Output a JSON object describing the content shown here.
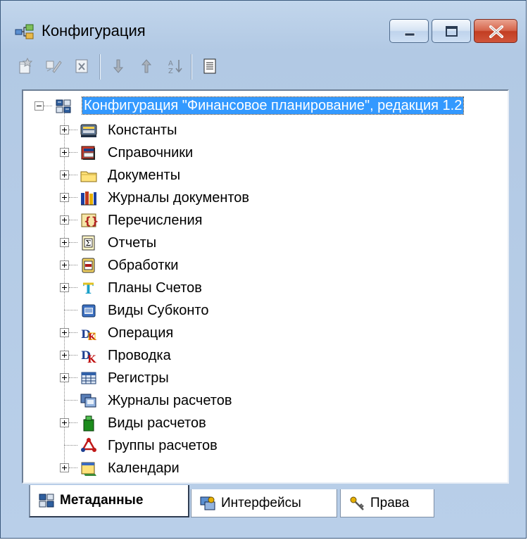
{
  "window": {
    "title": "Конфигурация",
    "controls": {
      "minimize": "minimize-icon",
      "maximize": "maximize-icon",
      "close": "close-icon"
    }
  },
  "toolbar": {
    "buttons": [
      {
        "icon": "new-item-icon"
      },
      {
        "icon": "edit-item-icon"
      },
      {
        "icon": "delete-item-icon"
      },
      {
        "icon": "move-down-icon"
      },
      {
        "icon": "move-up-icon"
      },
      {
        "icon": "sort-az-icon"
      },
      {
        "icon": "properties-icon"
      }
    ]
  },
  "tree": {
    "root": {
      "label": "Конфигурация \"Финансовое планирование\", редакция 1.2",
      "expanded": true,
      "selected": true
    },
    "items": [
      {
        "label": "Константы",
        "expandable": true,
        "icon": "constants-icon"
      },
      {
        "label": "Справочники",
        "expandable": true,
        "icon": "catalogs-icon"
      },
      {
        "label": "Документы",
        "expandable": true,
        "icon": "documents-folder-icon"
      },
      {
        "label": "Журналы документов",
        "expandable": true,
        "icon": "document-journals-icon"
      },
      {
        "label": "Перечисления",
        "expandable": true,
        "icon": "enumerations-icon"
      },
      {
        "label": "Отчеты",
        "expandable": true,
        "icon": "reports-icon"
      },
      {
        "label": "Обработки",
        "expandable": true,
        "icon": "processing-icon"
      },
      {
        "label": "Планы Счетов",
        "expandable": true,
        "icon": "chart-of-accounts-icon"
      },
      {
        "label": "Виды Субконто",
        "expandable": false,
        "icon": "subconto-types-icon"
      },
      {
        "label": "Операция",
        "expandable": true,
        "icon": "operation-icon"
      },
      {
        "label": "Проводка",
        "expandable": true,
        "icon": "entry-icon"
      },
      {
        "label": "Регистры",
        "expandable": true,
        "icon": "registers-icon"
      },
      {
        "label": "Журналы расчетов",
        "expandable": false,
        "icon": "calculation-journals-icon"
      },
      {
        "label": "Виды расчетов",
        "expandable": true,
        "icon": "calculation-types-icon"
      },
      {
        "label": "Группы расчетов",
        "expandable": false,
        "icon": "calculation-groups-icon"
      },
      {
        "label": "Календари",
        "expandable": true,
        "icon": "calendars-icon"
      }
    ]
  },
  "tabs": [
    {
      "label": "Метаданные",
      "icon": "metadata-icon",
      "active": true
    },
    {
      "label": "Интерфейсы",
      "icon": "interfaces-icon",
      "active": false
    },
    {
      "label": "Права",
      "icon": "rights-icon",
      "active": false
    }
  ],
  "colors": {
    "selection": "#3399ff",
    "window_frame": "#b9cfe9",
    "close_button": "#c94a30"
  }
}
